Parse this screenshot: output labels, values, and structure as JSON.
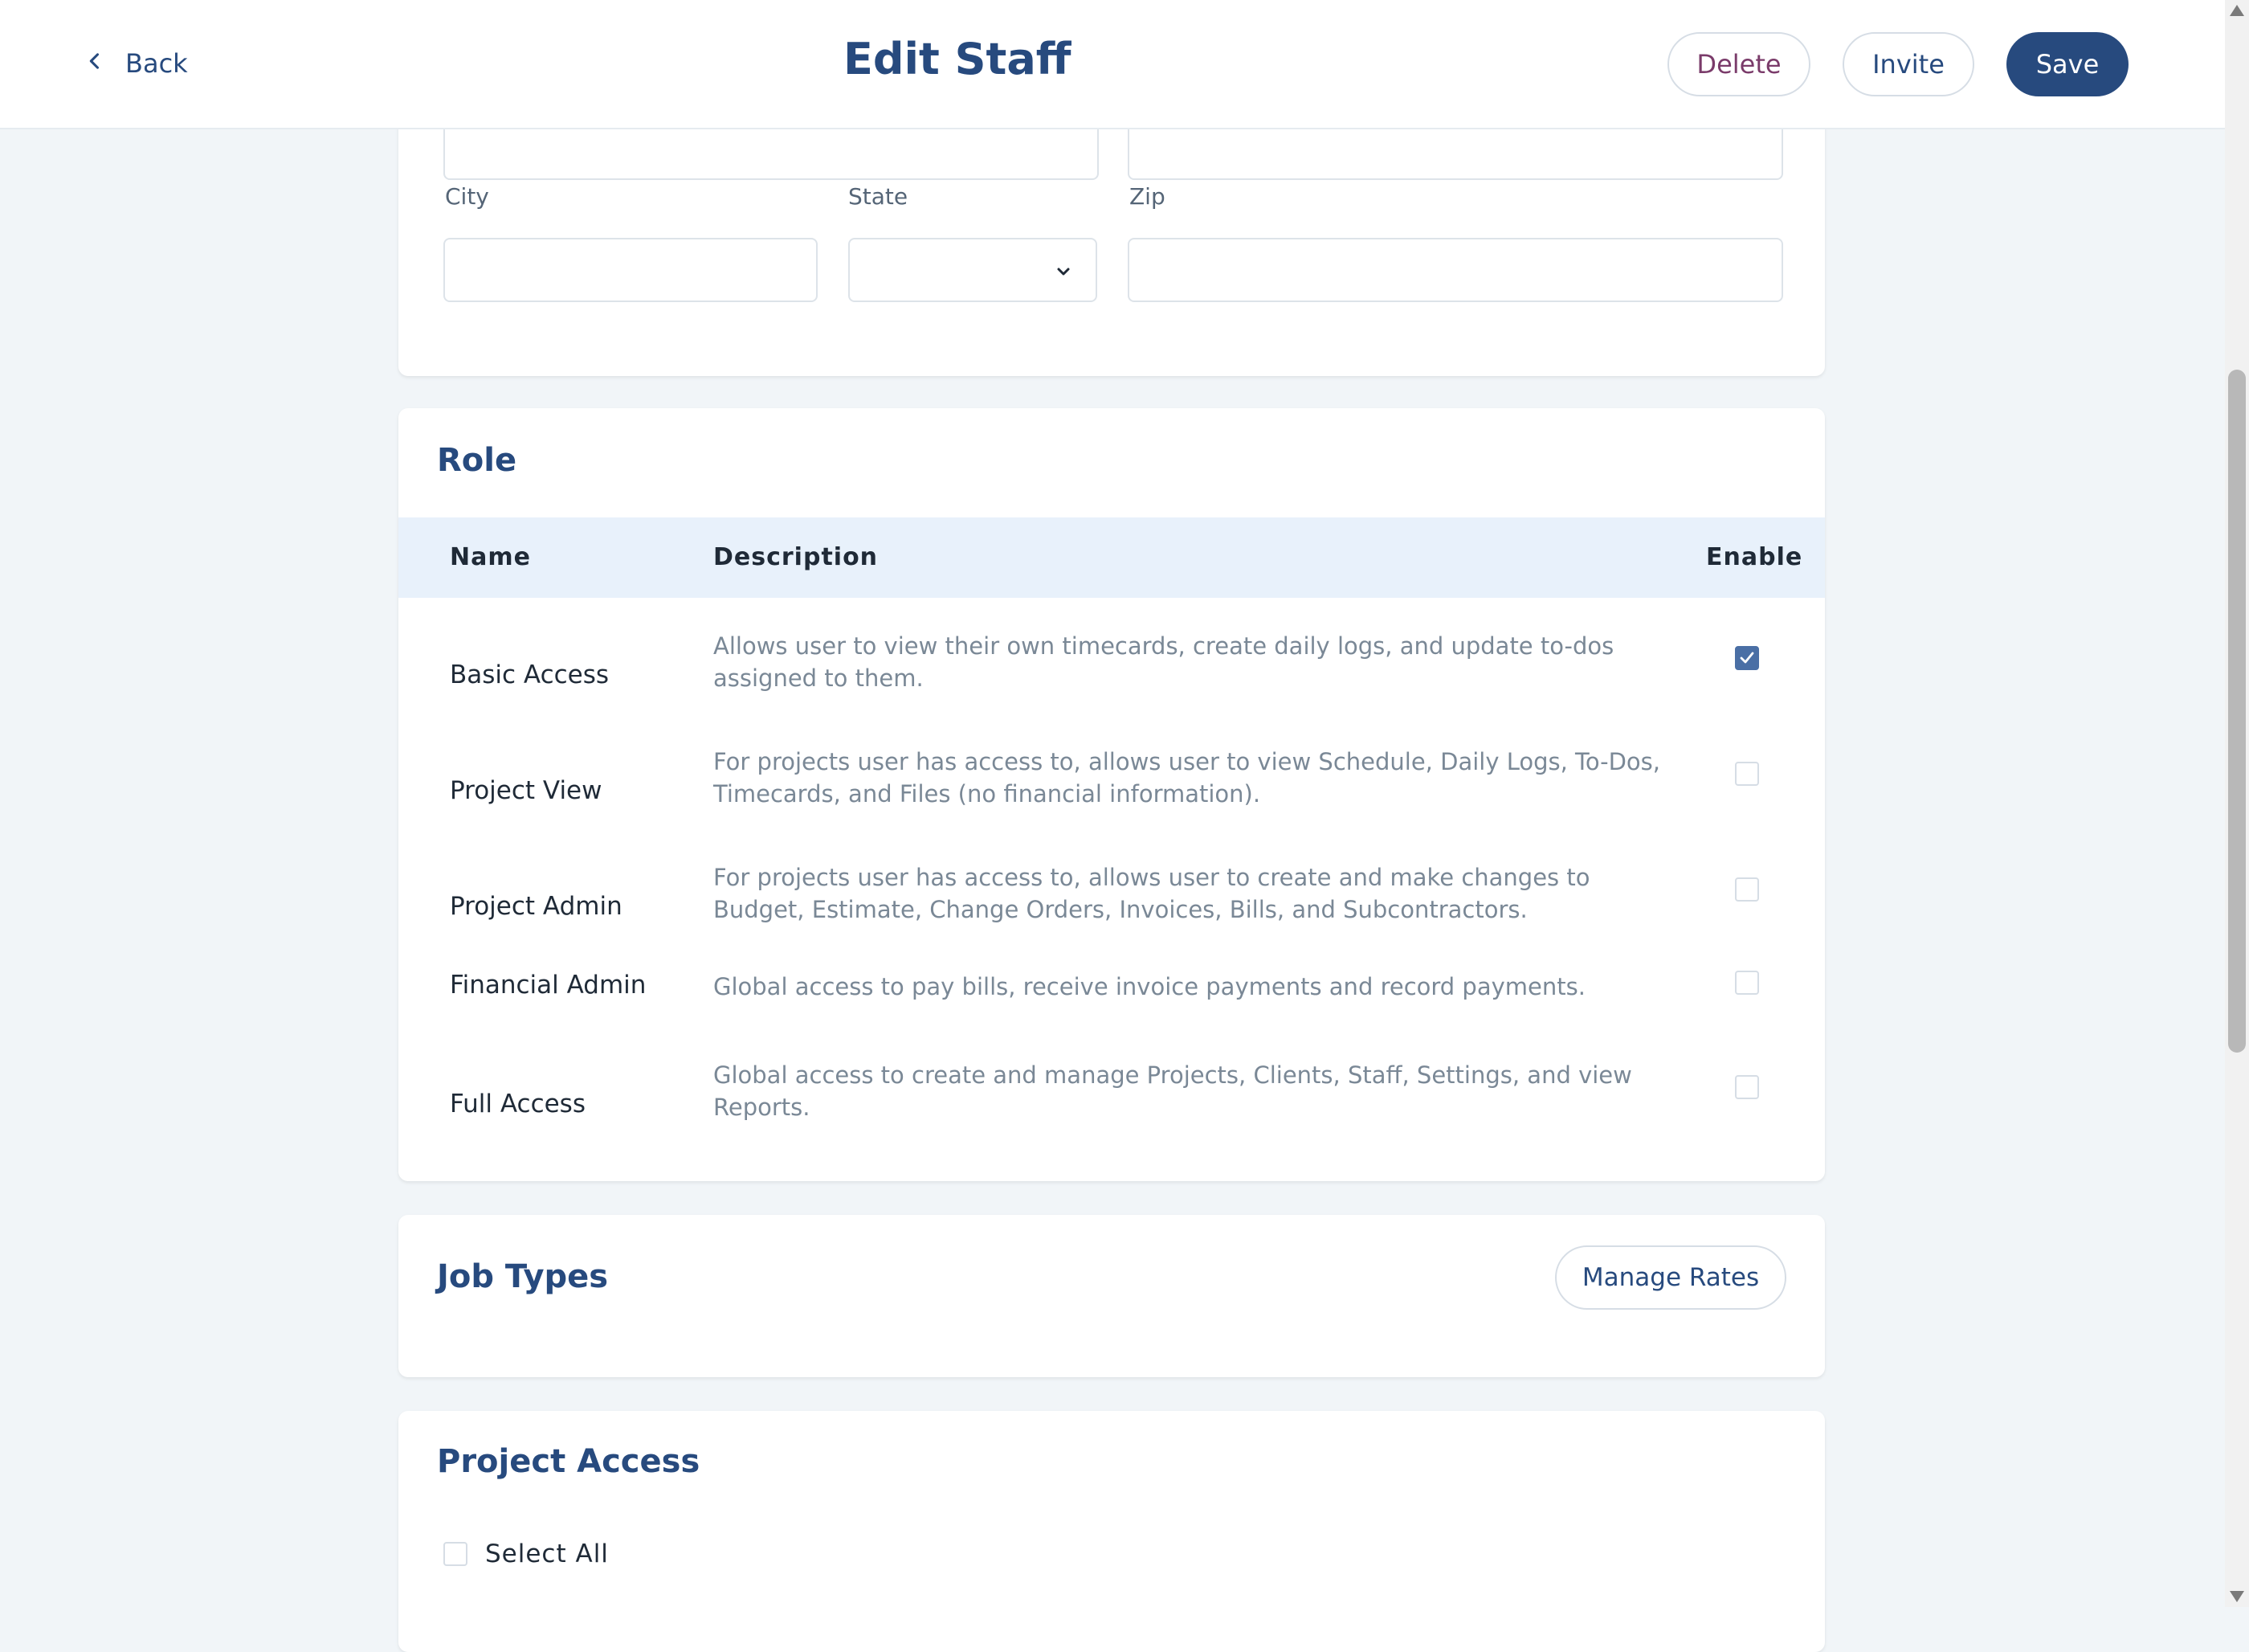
{
  "header": {
    "back_label": "Back",
    "title": "Edit Staff",
    "delete_label": "Delete",
    "invite_label": "Invite",
    "save_label": "Save"
  },
  "address": {
    "city_label": "City",
    "state_label": "State",
    "zip_label": "Zip",
    "city_value": "",
    "state_value": "",
    "zip_value": ""
  },
  "role": {
    "title": "Role",
    "columns": {
      "name": "Name",
      "description": "Description",
      "enable": "Enable"
    },
    "rows": [
      {
        "name": "Basic Access",
        "description": "Allows user to view their own timecards, create daily logs, and update to-dos assigned to them.",
        "enabled": true
      },
      {
        "name": "Project View",
        "description": "For projects user has access to, allows user to view Schedule, Daily Logs, To-Dos, Timecards, and Files (no financial information).",
        "enabled": false
      },
      {
        "name": "Project Admin",
        "description": "For projects user has access to, allows user to create and make changes to Budget, Estimate, Change Orders, Invoices, Bills, and Subcontractors.",
        "enabled": false
      },
      {
        "name": "Financial Admin",
        "description": "Global access to pay bills, receive invoice payments and record payments.",
        "enabled": false
      },
      {
        "name": "Full Access",
        "description": "Global access to create and manage Projects, Clients, Staff, Settings, and view Reports.",
        "enabled": false
      }
    ]
  },
  "job_types": {
    "title": "Job Types",
    "manage_rates_label": "Manage Rates"
  },
  "project_access": {
    "title": "Project Access",
    "select_all_label": "Select All",
    "select_all_checked": false
  },
  "colors": {
    "brand": "#274a7e",
    "header_row": "#e8f1fb",
    "checked": "#4a6fa5",
    "delete_text": "#7a3b6a"
  },
  "icons": [
    "chevron-left-icon",
    "chevron-down-icon",
    "checkmark-icon"
  ]
}
